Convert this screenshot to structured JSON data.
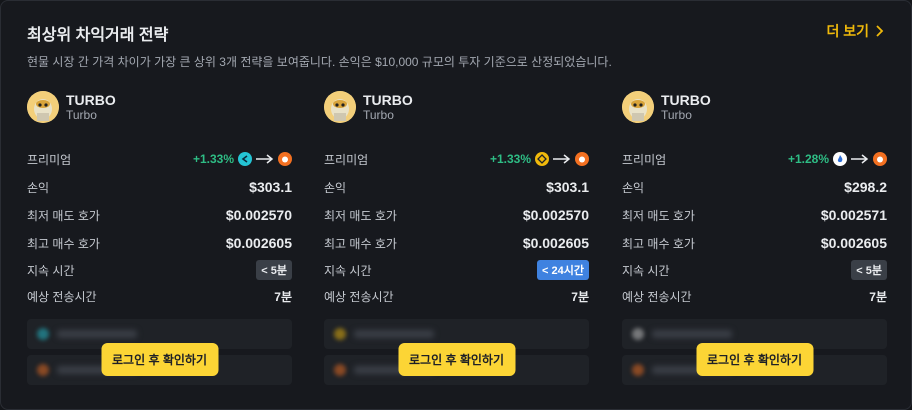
{
  "header": {
    "title": "최상위 차익거래 전략",
    "subtitle": "현물 시장 간 가격 차이가 가장 큰 상위 3개 전략을 보여줍니다. 손익은 $10,000 규모의 투자 기준으로 산정되었습니다.",
    "more_label": "더 보기"
  },
  "labels": {
    "premium": "프리미엄",
    "pnl": "손익",
    "lowest_ask": "최저 매도 호가",
    "highest_bid": "최고 매수 호가",
    "duration": "지속 시간",
    "transfer_time": "예상 전송시간",
    "login_button": "로그인 후 확인하기"
  },
  "cards": [
    {
      "symbol": "TURBO",
      "name": "Turbo",
      "premium": "+1.33%",
      "from_exchange_icon": "exchange-teal-s-icon",
      "to_exchange_icon": "exchange-orange-icon",
      "pnl": "$303.1",
      "lowest_ask": "$0.002570",
      "highest_bid": "$0.002605",
      "duration": "< 5분",
      "transfer_time": "7분"
    },
    {
      "symbol": "TURBO",
      "name": "Turbo",
      "premium": "+1.33%",
      "from_exchange_icon": "exchange-yellow-diamond-icon",
      "to_exchange_icon": "exchange-orange-icon",
      "pnl": "$303.1",
      "lowest_ask": "$0.002570",
      "highest_bid": "$0.002605",
      "duration": "< 24시간",
      "transfer_time": "7분"
    },
    {
      "symbol": "TURBO",
      "name": "Turbo",
      "premium": "+1.28%",
      "from_exchange_icon": "exchange-white-flame-icon",
      "to_exchange_icon": "exchange-orange-icon",
      "pnl": "$298.2",
      "lowest_ask": "$0.002571",
      "highest_bid": "$0.002605",
      "duration": "< 5분",
      "transfer_time": "7분"
    }
  ],
  "colors": {
    "accent": "#f0b90b",
    "positive": "#2ebd85",
    "button": "#fcd535",
    "badge_blue": "#3f82e0"
  }
}
